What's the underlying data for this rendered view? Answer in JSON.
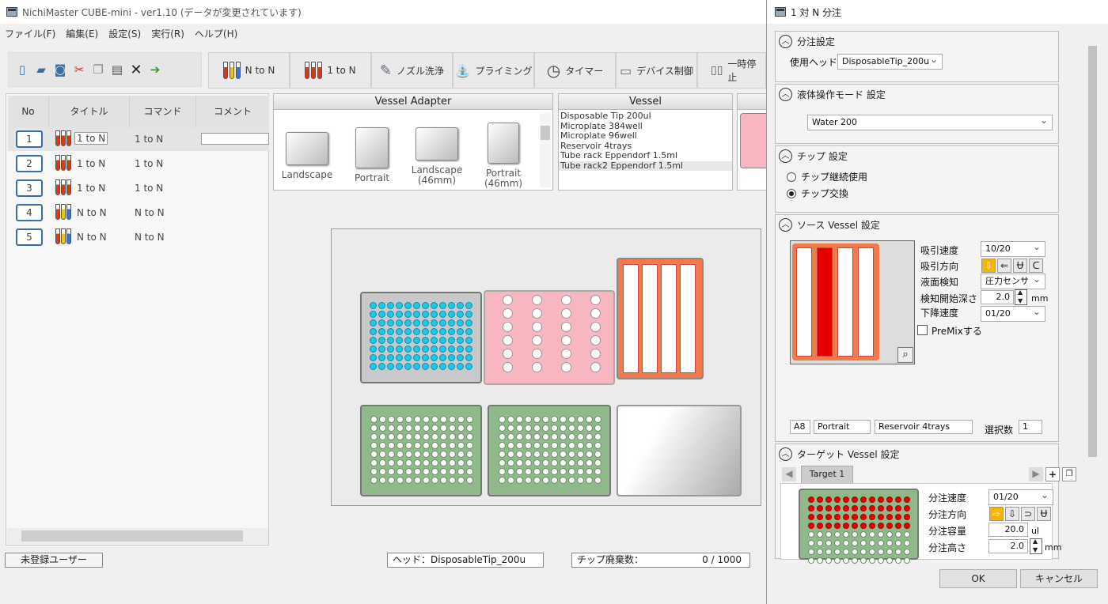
{
  "app": {
    "title": "NichiMaster CUBE-mini -  ver1.10 (データが変更されています)"
  },
  "menu": [
    "ファイル(F)",
    "編集(E)",
    "設定(S)",
    "実行(R)",
    "ヘルプ(H)"
  ],
  "toolbar": {
    "buttons": [
      {
        "label": "N to N"
      },
      {
        "label": "1 to N"
      },
      {
        "label": "ノズル洗浄"
      },
      {
        "label": "プライミング"
      },
      {
        "label": "タイマー"
      },
      {
        "label": "デバイス制御"
      },
      {
        "label": "一時停止"
      }
    ]
  },
  "list": {
    "headers": [
      "No",
      "タイトル",
      "コマンド",
      "コメント"
    ],
    "rows": [
      {
        "no": "1",
        "title": "1 to N",
        "command": "1 to N",
        "kind": "red"
      },
      {
        "no": "2",
        "title": "1 to N",
        "command": "1 to N",
        "kind": "red"
      },
      {
        "no": "3",
        "title": "1 to N",
        "command": "1 to N",
        "kind": "red"
      },
      {
        "no": "4",
        "title": "N to N",
        "command": "N to N",
        "kind": "mixed"
      },
      {
        "no": "5",
        "title": "N to N",
        "command": "N to N",
        "kind": "mixed"
      }
    ]
  },
  "vessel_adapter": {
    "title": "Vessel Adapter",
    "items": [
      {
        "line1": "Landscape",
        "line2": ""
      },
      {
        "line1": "Portrait",
        "line2": ""
      },
      {
        "line1": "Landscape",
        "line2": "(46mm)"
      },
      {
        "line1": "Portrait",
        "line2": "(46mm)"
      }
    ]
  },
  "vessel": {
    "title": "Vessel",
    "items": [
      "Disposable Tip 200ul",
      "Microplate 384well",
      "Microplate 96well",
      "Reservoir 4trays",
      "Tube rack Eppendorf 1.5ml",
      "Tube rack2 Eppendorf 1.5ml"
    ]
  },
  "status": {
    "user": "未登録ユーザー",
    "head": "ヘッド：DisposableTip_200u",
    "tip_label": "チップ廃棄数：",
    "tip_value": "0 / 1000"
  },
  "dialog": {
    "title": "1 対 N 分注",
    "dispense_settings": {
      "title": "分注設定",
      "head_label": "使用ヘッド",
      "head_value": "DisposableTip_200u"
    },
    "liquid_mode": {
      "title": "液体操作モード 設定",
      "value": "Water 200"
    },
    "tip": {
      "title": "チップ 設定",
      "option1": "チップ継続使用",
      "option2": "チップ交換",
      "selected": 2
    },
    "source": {
      "title": "ソース Vessel 設定",
      "aspirate_speed_label": "吸引速度",
      "aspirate_speed": "10/20",
      "aspirate_dir_label": "吸引方向",
      "liquid_detect_label": "液面検知",
      "liquid_detect": "圧力センサ",
      "detect_depth_label": "検知開始深さ",
      "detect_depth": "2.0",
      "detect_unit": "mm",
      "descend_speed_label": "下降速度",
      "descend_speed": "01/20",
      "premix_label": "PreMixする",
      "position": "A8",
      "adapter": "Portrait",
      "vessel": "Reservoir 4trays",
      "count_label": "選択数",
      "count": "1"
    },
    "target": {
      "title": "ターゲット Vessel 設定",
      "tab": "Target 1",
      "speed_label": "分注速度",
      "speed": "01/20",
      "dir_label": "分注方向",
      "volume_label": "分注容量",
      "volume": "20.0",
      "volume_unit": "ul",
      "height_label": "分注高さ",
      "height": "2.0",
      "height_unit": "mm"
    },
    "ok": "OK",
    "cancel": "キャンセル"
  },
  "colors": {
    "cyan_well": "#1ec8e6",
    "pink_rack": "#f8b6c0",
    "green_plate": "#8fb98a",
    "orange_reservoir": "#f07a4a",
    "red_selected": "#e60000"
  }
}
